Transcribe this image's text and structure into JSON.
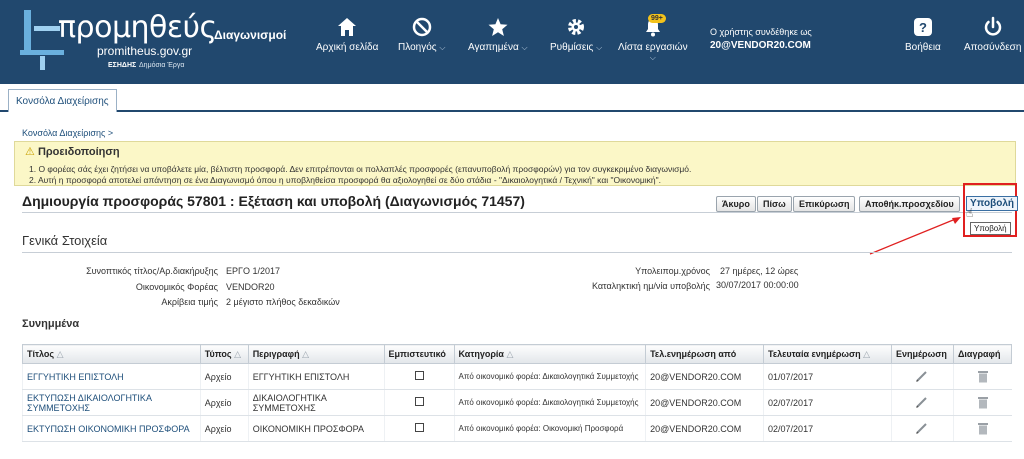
{
  "header": {
    "logo_title": "προμηθεύς",
    "logo_site": "promitheus.gov.gr",
    "logo_esidis": "ΕΣΗΔΗΣ",
    "logo_dimosia": "Δημόσια Έργα",
    "app_title": "Διαγωνισμοί",
    "nav": {
      "home": "Αρχική σελίδα",
      "navigation": "Πλοηγός",
      "favorites": "Αγαπημένα",
      "settings": "Ρυθμίσεις",
      "tasks": "Λίστα εργασιών",
      "help": "Βοήθεια",
      "logout": "Αποσύνδεση"
    },
    "tasks_badge": "99+",
    "login_prefix": "Ο χρήστης συνδέθηκε ως",
    "login_user": "20@VENDOR20.COM"
  },
  "tabs": {
    "console": "Κονσόλα Διαχείρισης"
  },
  "breadcrumb": "Κονσόλα Διαχείρισης  >",
  "warning": {
    "title": "Προειδοποίηση",
    "line1": "1. Ο φορέας σάς έχει ζητήσει να υποβάλετε μία, βέλτιστη προσφορά. Δεν επιτρέπονται οι πολλαπλές προσφορές (επανυποβολή προσφορών) για τον συγκεκριμένο διαγωνισμό.",
    "line2": "2. Αυτή η προσφορά αποτελεί απάντηση σε ένα Διαγωνισμό όπου η υποβληθείσα προσφορά θα αξιολογηθεί σε δύο στάδια - \"Δικαιολογητικά / Τεχνική\" και \"Οικονομική\"."
  },
  "page_title": "Δημιουργία προσφοράς 57801 : Εξέταση και υποβολή (Διαγωνισμός 71457)",
  "buttons": {
    "cancel": "Άκυρο",
    "back": "Πίσω",
    "confirm": "Επικύρωση",
    "save_draft": "Αποθήκ.προσχεδίου",
    "submit": "Υποβολή",
    "submit_tooltip": "Υποβολή"
  },
  "general": {
    "title": "Γενικά Στοιχεία",
    "title_label": "Συνοπτικός τίτλος/Αρ.διακήρυξης",
    "title_value": "ΕΡΓΟ 1/2017",
    "operator_label": "Οικονομικός Φορέας",
    "operator_value": "VENDOR20",
    "precision_label": "Ακρίβεια τιμής",
    "precision_value": "2 μέγιστο πλήθος δεκαδικών",
    "remaining_label": "Υπολειπομ.χρόνος",
    "remaining_value": "27 ημέρες, 12 ώρες",
    "deadline_label": "Καταληκτική ημ/νία υποβολής",
    "deadline_value": "30/07/2017 00:00:00"
  },
  "attachments": {
    "title": "Συνημμένα",
    "columns": {
      "title": "Τίτλος",
      "type": "Τύπος",
      "description": "Περιγραφή",
      "confidential": "Εμπιστευτικό",
      "category": "Κατηγορία",
      "updated_by": "Τελ.ενημέρωση από",
      "last_update": "Τελευταία ενημέρωση",
      "update": "Ενημέρωση",
      "delete": "Διαγραφή"
    },
    "rows": [
      {
        "title": "ΕΓΓΥΗΤΙΚΗ ΕΠΙΣΤΟΛΗ",
        "type": "Αρχείο",
        "description": "ΕΓΓΥΗΤΙΚΗ ΕΠΙΣΤΟΛΗ",
        "category": "Από οικονομικό φορέα: Δικαιολογητικά Συμμετοχής",
        "updated_by": "20@VENDOR20.COM",
        "last_update": "01/07/2017"
      },
      {
        "title": "ΕΚΤΥΠΩΣΗ ΔΙΚΑΙΟΛΟΓΗΤΙΚΑ ΣΥΜΜΕΤΟΧΗΣ",
        "type": "Αρχείο",
        "description": "ΔΙΚΑΙΟΛΟΓΗΤΙΚΑ ΣΥΜΜΕΤΟΧΗΣ",
        "category": "Από οικονομικό φορέα: Δικαιολογητικά Συμμετοχής",
        "updated_by": "20@VENDOR20.COM",
        "last_update": "02/07/2017"
      },
      {
        "title": "ΕΚΤΥΠΩΣΗ ΟΙΚΟΝΟΜΙΚΗ ΠΡΟΣΦΟΡΑ",
        "type": "Αρχείο",
        "description": "ΟΙΚΟΝΟΜΙΚΗ ΠΡΟΣΦΟΡΑ",
        "category": "Από οικονομικό φορέα: Οικονομική Προσφορά",
        "updated_by": "20@VENDOR20.COM",
        "last_update": "02/07/2017"
      }
    ]
  },
  "icons": {
    "home": "home-icon",
    "navigator": "compass-icon",
    "favorites": "star-icon",
    "settings": "gear-icon",
    "tasks": "bell-icon",
    "help": "help-icon",
    "logout": "power-icon",
    "warning": "warning-icon",
    "edit": "pencil-icon",
    "delete": "trash-icon",
    "sort": "sort-icon"
  },
  "colors": {
    "header_bg": "#21486e",
    "link": "#1d4e7a",
    "warning_bg": "#fbf7c7",
    "highlight": "#e02020",
    "badge": "#f3c21b"
  }
}
